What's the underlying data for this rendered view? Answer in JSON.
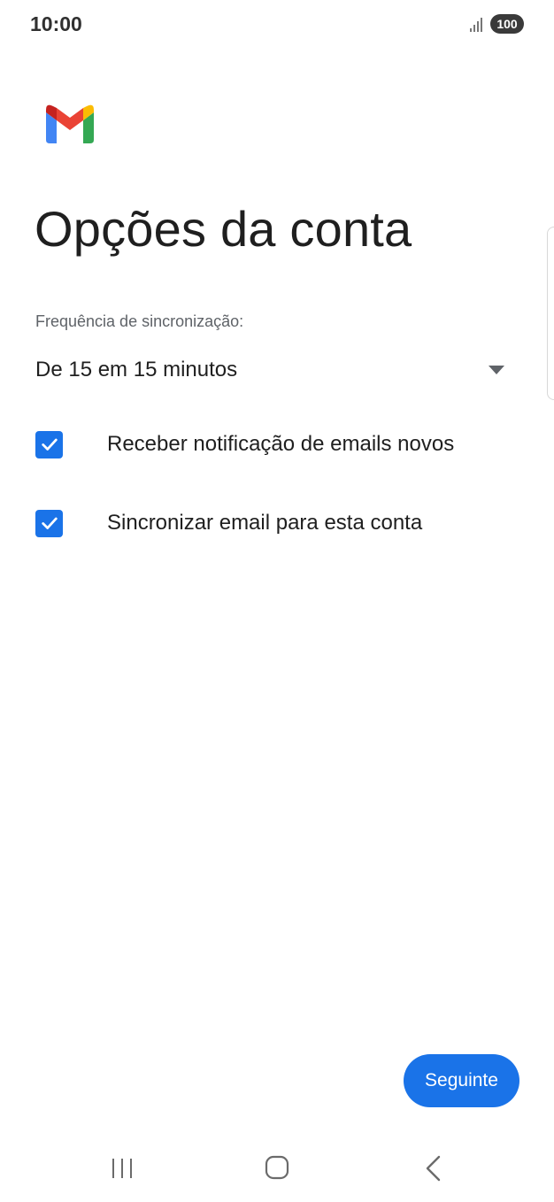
{
  "status_bar": {
    "time": "10:00",
    "battery": "100",
    "icons": [
      "signal-icon",
      "battery-icon"
    ]
  },
  "app": {
    "logo": "gmail-logo",
    "colors": {
      "primary": "#1a73e8",
      "red": "#ea4335",
      "yellow": "#fbbc04",
      "green": "#34a853",
      "blue": "#4285f4"
    }
  },
  "page": {
    "title": "Opções da conta",
    "sync_label": "Frequência de sincronização:",
    "sync_value": "De 15 em 15 minutos",
    "options": [
      {
        "label": "Receber notificação de emails novos",
        "checked": true
      },
      {
        "label": "Sincronizar email para esta conta",
        "checked": true
      }
    ],
    "next_button": "Seguinte"
  },
  "nav_bar": {
    "icons": [
      "recent-apps-icon",
      "home-icon",
      "back-icon"
    ]
  }
}
